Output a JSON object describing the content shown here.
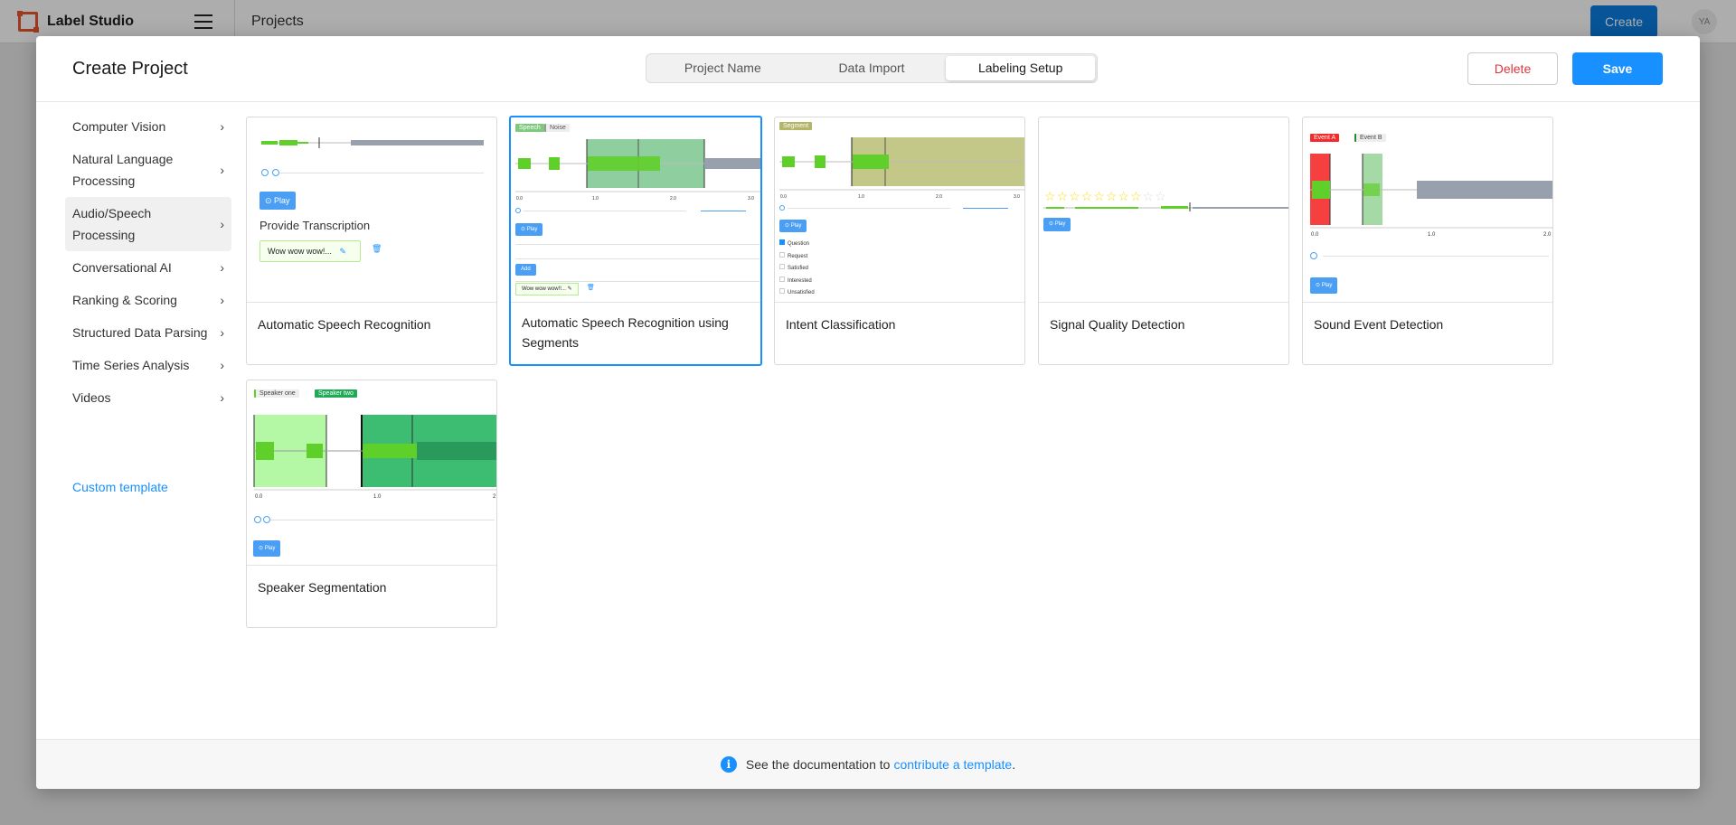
{
  "app": {
    "name": "Label Studio",
    "breadcrumb": "Projects",
    "create_label": "Create",
    "avatar_initials": "YA"
  },
  "modal": {
    "title": "Create Project",
    "tabs": [
      {
        "label": "Project Name",
        "active": false
      },
      {
        "label": "Data Import",
        "active": false
      },
      {
        "label": "Labeling Setup",
        "active": true
      }
    ],
    "delete_label": "Delete",
    "save_label": "Save"
  },
  "sidebar": {
    "items": [
      {
        "label": "Computer Vision"
      },
      {
        "label": "Natural Language Processing"
      },
      {
        "label": "Audio/Speech Processing",
        "active": true
      },
      {
        "label": "Conversational AI"
      },
      {
        "label": "Ranking & Scoring"
      },
      {
        "label": "Structured Data Parsing"
      },
      {
        "label": "Time Series Analysis"
      },
      {
        "label": "Videos"
      }
    ],
    "custom_template": "Custom template"
  },
  "templates": [
    {
      "title": "Automatic Speech Recognition",
      "preview": {
        "play": "Play",
        "heading": "Provide Transcription",
        "text": "Wow wow wow!..."
      }
    },
    {
      "title": "Automatic Speech Recognition using Segments",
      "selected": true,
      "preview": {
        "labels": [
          "Speech",
          "Noise"
        ],
        "play": "Play",
        "add": "Add",
        "text": "Wow wow wow!!..."
      }
    },
    {
      "title": "Intent Classification",
      "preview": {
        "label": "Segment",
        "play": "Play",
        "choices": [
          "Question",
          "Request",
          "Satisfied",
          "Interested",
          "Unsatisfied"
        ]
      }
    },
    {
      "title": "Signal Quality Detection",
      "preview": {
        "play": "Play",
        "stars": 8,
        "max_stars": 10
      }
    },
    {
      "title": "Sound Event Detection",
      "preview": {
        "labels": [
          "Event A",
          "Event B"
        ],
        "play": "Play",
        "ticks": [
          "0.0",
          "1.0",
          "2.0"
        ]
      }
    },
    {
      "title": "Speaker Segmentation",
      "preview": {
        "labels": [
          "Speaker one",
          "Speaker two"
        ],
        "play": "Play",
        "ticks": [
          "0.0",
          "1.0",
          "2"
        ]
      }
    }
  ],
  "footer": {
    "text": "See the documentation to",
    "link": "contribute a template",
    "suffix": "."
  },
  "colors": {
    "primary": "#1890ff",
    "danger": "#d9363e",
    "waveform_green": "#5fcf2a",
    "waveform_gray": "#98a0ad"
  }
}
